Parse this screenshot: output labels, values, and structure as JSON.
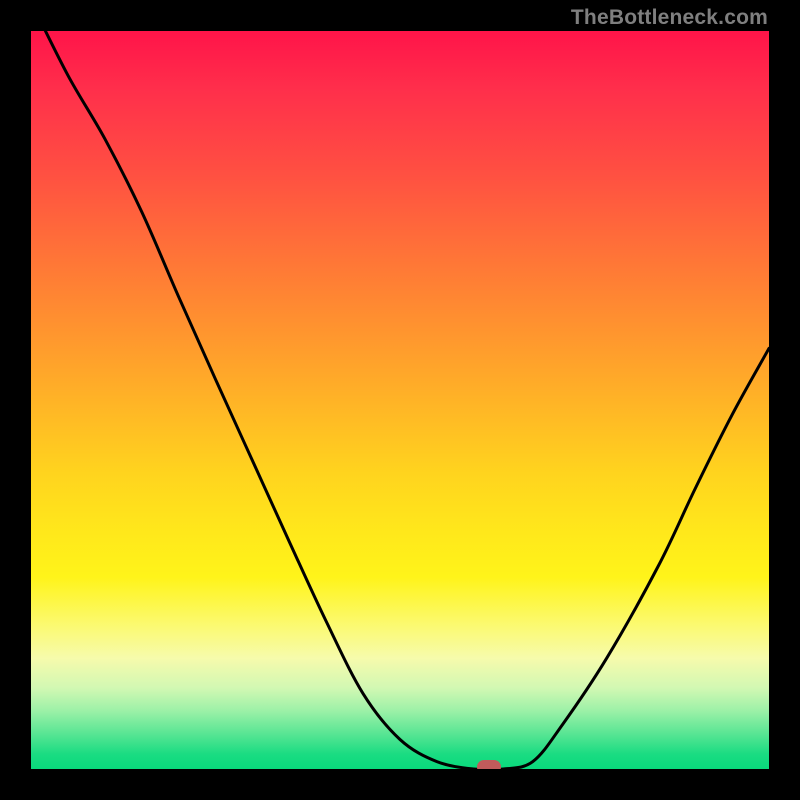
{
  "watermark": "TheBottleneck.com",
  "colors": {
    "frame": "#000000",
    "curve": "#000000",
    "marker": "#C15B5B",
    "gradient_top": "#ff1449",
    "gradient_bottom": "#09d97c"
  },
  "chart_data": {
    "type": "line",
    "x": [
      0.0,
      0.05,
      0.1,
      0.15,
      0.2,
      0.25,
      0.3,
      0.35,
      0.4,
      0.45,
      0.5,
      0.55,
      0.6,
      0.64,
      0.68,
      0.72,
      0.78,
      0.85,
      0.9,
      0.95,
      1.0
    ],
    "values": [
      1.04,
      0.94,
      0.854,
      0.755,
      0.64,
      0.528,
      0.418,
      0.308,
      0.2,
      0.102,
      0.04,
      0.01,
      0.0,
      0.0,
      0.01,
      0.06,
      0.15,
      0.275,
      0.38,
      0.48,
      0.57
    ],
    "title": "",
    "xlabel": "",
    "ylabel": "",
    "xlim": [
      0,
      1
    ],
    "ylim": [
      0,
      1
    ],
    "grid": false,
    "marker": {
      "x": 0.62,
      "y": 0.0
    },
    "note": "Values normalized to plot-area width/height; chart has no visible axis ticks or labels."
  }
}
